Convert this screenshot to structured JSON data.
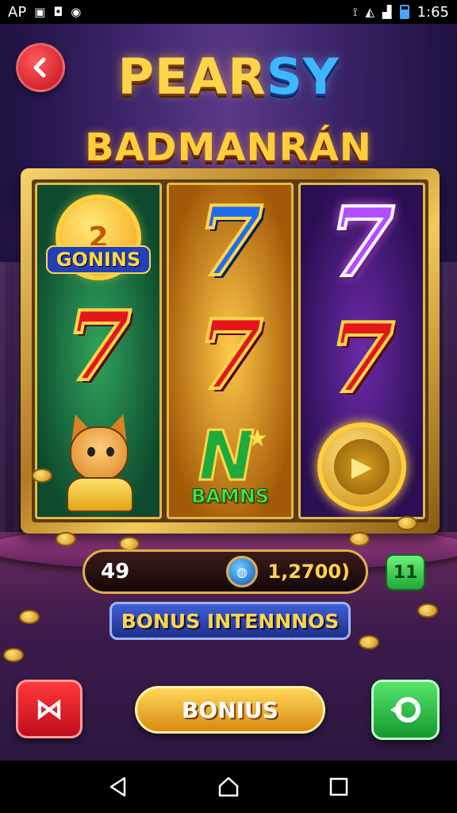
{
  "status_bar": {
    "left_text": "AP",
    "time": "1:65",
    "icons": [
      "image-icon",
      "chat-icon",
      "shield-icon",
      "vibrate-icon",
      "wifi-icon",
      "signal-icon",
      "battery-icon"
    ]
  },
  "game": {
    "title_line1_a": "PEAR",
    "title_line1_b": "SY",
    "title_line2": "BADMANRÁN",
    "reel_badge_number": "2",
    "reel_badge_label": "GONINS",
    "reel_bonus_label": "BAMNS",
    "bet_value": "49",
    "balance_value": "1,2700)",
    "side_button_label": "11",
    "banner_text": "BONUS INTENNNOS",
    "bonus_button_label": "BONIUS",
    "colors": {
      "gold": "#ffd54a",
      "red_button": "#e01a24",
      "green_button": "#2ec24a",
      "title_blue": "#3fb7ff"
    }
  },
  "nav": {
    "buttons": [
      "back-nav",
      "home-nav",
      "recents-nav"
    ]
  }
}
